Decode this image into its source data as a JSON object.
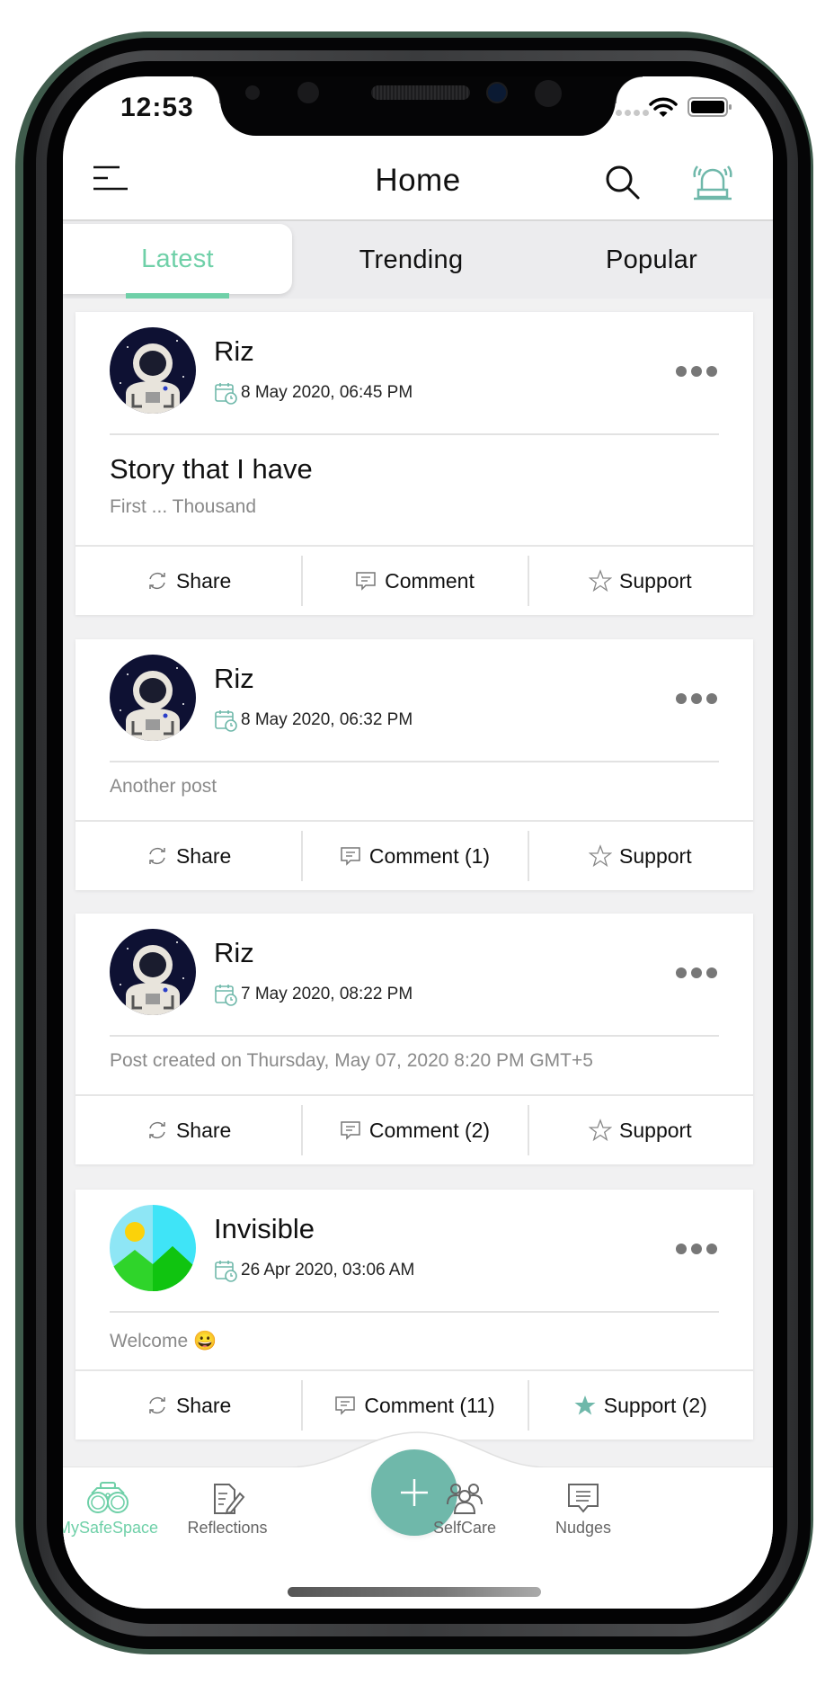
{
  "status_bar": {
    "time": "12:53"
  },
  "header": {
    "title": "Home"
  },
  "tabs": [
    {
      "label": "Latest",
      "active": true
    },
    {
      "label": "Trending",
      "active": false
    },
    {
      "label": "Popular",
      "active": false
    }
  ],
  "posts": [
    {
      "author": "Riz",
      "avatar": "astronaut",
      "date": "8 May 2020, 06:45 PM",
      "title": "Story that I have",
      "text": "First ... Thousand",
      "share_label": "Share",
      "comment_label": "Comment",
      "support_label": "Support",
      "supported": false
    },
    {
      "author": "Riz",
      "avatar": "astronaut",
      "date": "8 May 2020, 06:32 PM",
      "title": "",
      "text": "Another post",
      "share_label": "Share",
      "comment_label": "Comment (1)",
      "support_label": "Support",
      "supported": false
    },
    {
      "author": "Riz",
      "avatar": "astronaut",
      "date": "7 May 2020, 08:22 PM",
      "title": "",
      "text": "Post created on Thursday, May 07, 2020 8:20 PM GMT+5",
      "share_label": "Share",
      "comment_label": "Comment (2)",
      "support_label": "Support",
      "supported": false
    },
    {
      "author": "Invisible",
      "avatar": "landscape",
      "date": "26 Apr 2020, 03:06 AM",
      "title": "",
      "text": "Welcome 😀",
      "share_label": "Share",
      "comment_label": "Comment (11)",
      "support_label": "Support (2)",
      "supported": true
    }
  ],
  "bottom_nav": {
    "items": [
      {
        "label": "MySafeSpace",
        "icon": "binoculars-icon",
        "active": true
      },
      {
        "label": "Reflections",
        "icon": "journal-pen-icon",
        "active": false
      },
      {
        "label": "SelfCare",
        "icon": "people-group-icon",
        "active": false
      },
      {
        "label": "Nudges",
        "icon": "message-icon",
        "active": false
      }
    ],
    "fab_icon": "plus-icon"
  },
  "colors": {
    "accent": "#6fd0a8",
    "fab": "#6fb8aa",
    "phone_frame": "#3f5b4c",
    "tab_bg": "#ececee",
    "muted_text": "#8a8a8a"
  }
}
